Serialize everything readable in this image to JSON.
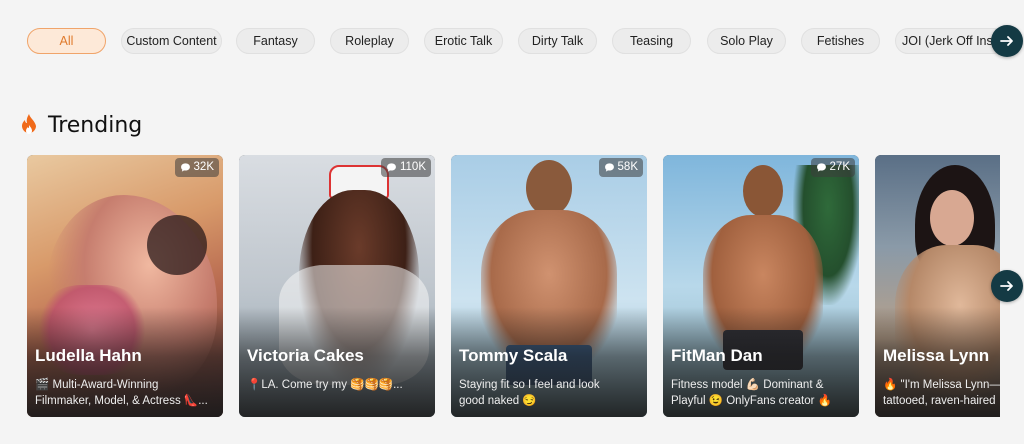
{
  "categories": {
    "items": [
      {
        "label": "All",
        "active": true
      },
      {
        "label": "Custom Content"
      },
      {
        "label": "Fantasy"
      },
      {
        "label": "Roleplay"
      },
      {
        "label": "Erotic Talk"
      },
      {
        "label": "Dirty Talk"
      },
      {
        "label": "Teasing"
      },
      {
        "label": "Solo Play"
      },
      {
        "label": "Fetishes"
      },
      {
        "label": "JOI (Jerk Off Inst"
      }
    ],
    "scroll_icon": "arrow-right-icon"
  },
  "trending": {
    "title": "Trending",
    "icon": "fire-icon",
    "accent": "#f06a1a",
    "cards": [
      {
        "name": "Ludella Hahn",
        "count": "32K",
        "line1": "🎬 Multi-Award-Winning",
        "line2": "Filmmaker, Model, & Actress 👠..."
      },
      {
        "name": "Victoria Cakes",
        "count": "110K",
        "line1": "📍LA. Come try my 🥞🥞🥞..."
      },
      {
        "name": "Tommy Scala",
        "count": "58K",
        "line1": "Staying fit so I feel and look",
        "line2": "good naked 😏"
      },
      {
        "name": "FitMan Dan",
        "count": "27K",
        "line1": "Fitness model 💪🏻 Dominant &",
        "line2": "Playful 😉 OnlyFans creator 🔥"
      },
      {
        "name": "Melissa Lynn",
        "line1": "🔥 \"I'm Melissa Lynn—",
        "line2": "tattooed, raven-haired"
      }
    ],
    "scroll_icon": "arrow-right-icon"
  }
}
